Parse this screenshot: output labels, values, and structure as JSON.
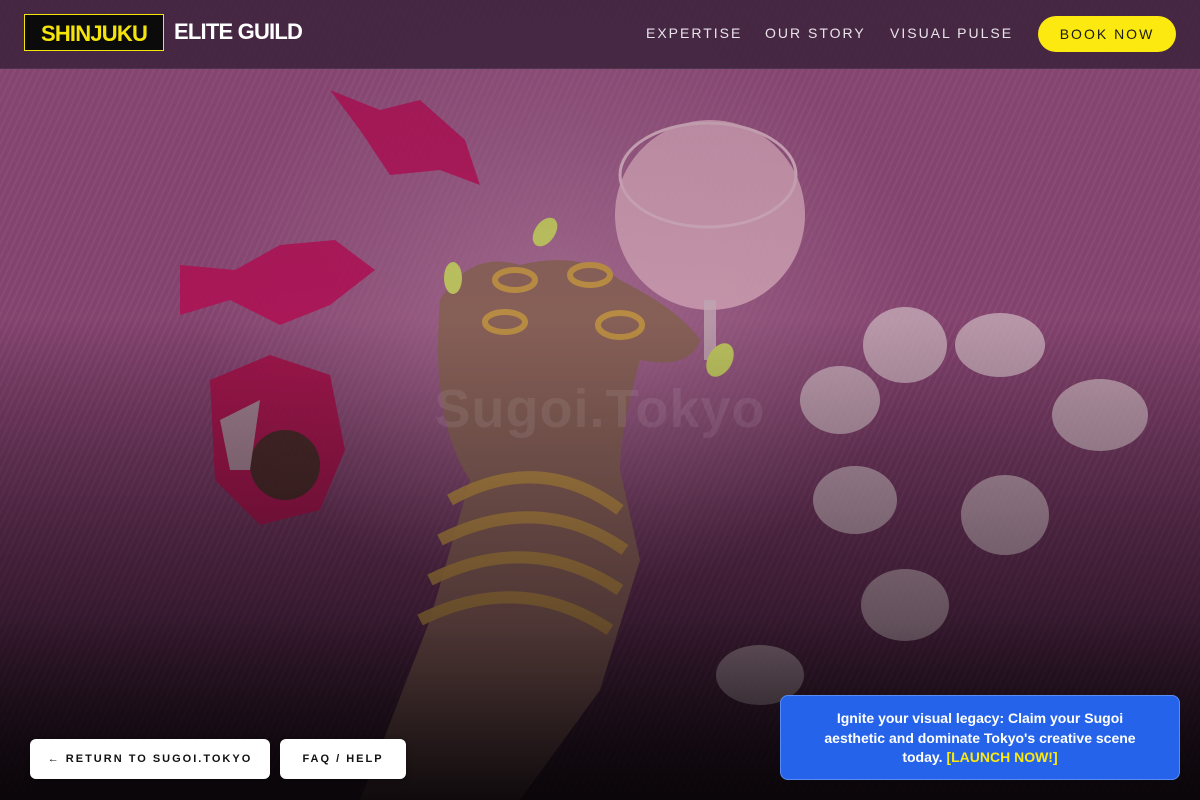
{
  "header": {
    "logo_box": "SHINJUKU",
    "logo_text": "ELITE GUILD",
    "nav": [
      "EXPERTISE",
      "OUR STORY",
      "VISUAL PULSE"
    ],
    "cta": "BOOK NOW"
  },
  "hero": {
    "watermark": "Sugoi.Tokyo"
  },
  "footer_buttons": {
    "return": "← RETURN TO SUGOI.TOKYO",
    "faq": "FAQ / HELP"
  },
  "promo": {
    "text": "Ignite your visual legacy: Claim your Sugoi aesthetic and dominate Tokyo's creative scene today.",
    "link": "[LAUNCH NOW!]"
  },
  "colors": {
    "accent_yellow": "#fbe90f",
    "promo_blue": "#2563eb",
    "header_bg": "#3c233c"
  }
}
